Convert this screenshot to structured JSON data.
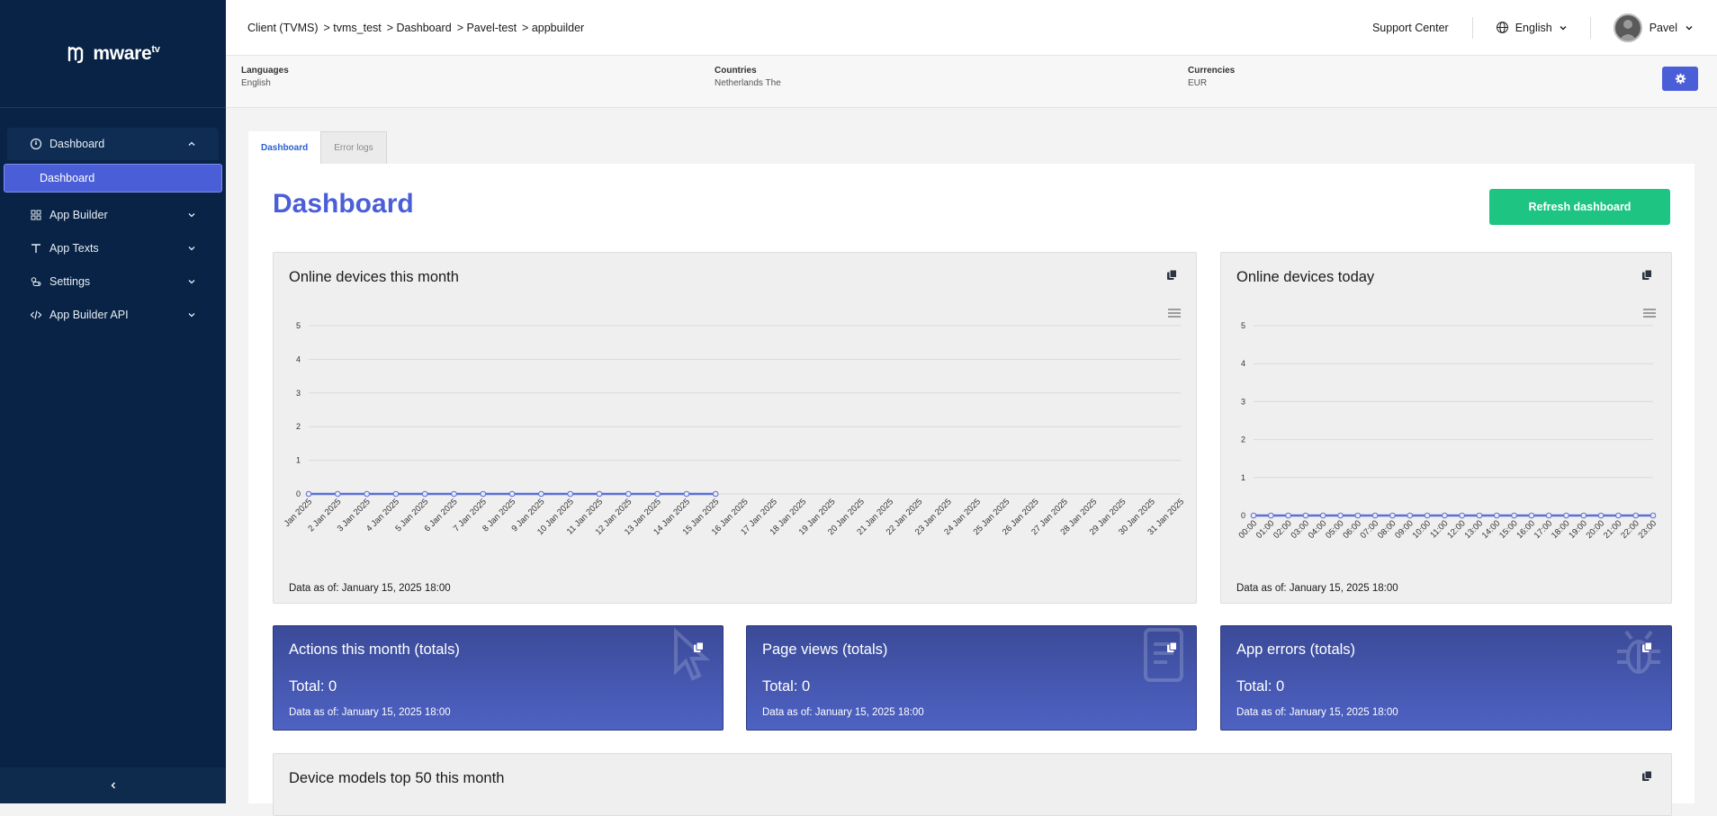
{
  "brand": {
    "name": "mware",
    "suffix": "tv"
  },
  "sidebar": {
    "group": {
      "label": "Dashboard",
      "sub_label": "Dashboard"
    },
    "items": [
      {
        "label": "App Builder",
        "icon": "grid-icon"
      },
      {
        "label": "App Texts",
        "icon": "text-icon"
      },
      {
        "label": "Settings",
        "icon": "settings-toggle-icon"
      },
      {
        "label": "App Builder API",
        "icon": "code-icon"
      }
    ]
  },
  "breadcrumb": [
    "Client (TVMS)",
    "> tvms_test",
    "> Dashboard",
    "> Pavel-test",
    "> appbuilder"
  ],
  "topbar": {
    "support": "Support Center",
    "language": "English",
    "user": "Pavel"
  },
  "info": {
    "languages_label": "Languages",
    "languages_value": "English",
    "countries_label": "Countries",
    "countries_value": "Netherlands The",
    "currencies_label": "Currencies",
    "currencies_value": "EUR"
  },
  "tabs": {
    "active": "Dashboard",
    "inactive": "Error logs"
  },
  "main": {
    "title": "Dashboard",
    "refresh": "Refresh dashboard"
  },
  "cards": {
    "month_title": "Online devices this month",
    "today_title": "Online devices today",
    "month_asof": "Data as of: January 15, 2025 18:00",
    "today_asof": "Data as of: January 15, 2025 18:00",
    "devices_title": "Device models top 50 this month"
  },
  "stats": [
    {
      "title": "Actions this month (totals)",
      "total": "Total: 0",
      "asof": "Data as of: January 15, 2025 18:00",
      "icon": "cursor-icon"
    },
    {
      "title": "Page views (totals)",
      "total": "Total: 0",
      "asof": "Data as of: January 15, 2025 18:00",
      "icon": "document-icon"
    },
    {
      "title": "App errors (totals)",
      "total": "Total: 0",
      "asof": "Data as of: January 15, 2025 18:00",
      "icon": "bug-icon"
    }
  ],
  "colors": {
    "accent": "#4a5ed8",
    "sidebar": "#082345",
    "success": "#1ec482",
    "series": "#5b6fd6"
  },
  "chart_data": [
    {
      "type": "line",
      "title": "Online devices this month",
      "ylim": [
        0,
        5
      ],
      "yticks": [
        "0",
        "1",
        "2",
        "3",
        "4",
        "5"
      ],
      "x": [
        "Jan 2025",
        "2 Jan 2025",
        "3 Jan 2025",
        "4 Jan 2025",
        "5 Jan 2025",
        "6 Jan 2025",
        "7 Jan 2025",
        "8 Jan 2025",
        "9 Jan 2025",
        "10 Jan 2025",
        "11 Jan 2025",
        "12 Jan 2025",
        "13 Jan 2025",
        "14 Jan 2025",
        "15 Jan 2025",
        "16 Jan 2025",
        "17 Jan 2025",
        "18 Jan 2025",
        "19 Jan 2025",
        "20 Jan 2025",
        "21 Jan 2025",
        "22 Jan 2025",
        "23 Jan 2025",
        "24 Jan 2025",
        "25 Jan 2025",
        "26 Jan 2025",
        "27 Jan 2025",
        "28 Jan 2025",
        "29 Jan 2025",
        "30 Jan 2025",
        "31 Jan 2025"
      ],
      "series": [
        {
          "values": [
            0,
            0,
            0,
            0,
            0,
            0,
            0,
            0,
            0,
            0,
            0,
            0,
            0,
            0,
            0
          ]
        }
      ],
      "grid": true
    },
    {
      "type": "line",
      "title": "Online devices today",
      "ylim": [
        0,
        5
      ],
      "yticks": [
        "0",
        "1",
        "2",
        "3",
        "4",
        "5"
      ],
      "x": [
        "00:00",
        "01:00",
        "02:00",
        "03:00",
        "04:00",
        "05:00",
        "06:00",
        "07:00",
        "08:00",
        "09:00",
        "10:00",
        "11:00",
        "12:00",
        "13:00",
        "14:00",
        "15:00",
        "16:00",
        "17:00",
        "18:00",
        "19:00",
        "20:00",
        "21:00",
        "22:00",
        "23:00"
      ],
      "series": [
        {
          "values": [
            0,
            0,
            0,
            0,
            0,
            0,
            0,
            0,
            0,
            0,
            0,
            0,
            0,
            0,
            0,
            0,
            0,
            0,
            0,
            0,
            0,
            0,
            0,
            0
          ]
        }
      ],
      "grid": true
    }
  ]
}
